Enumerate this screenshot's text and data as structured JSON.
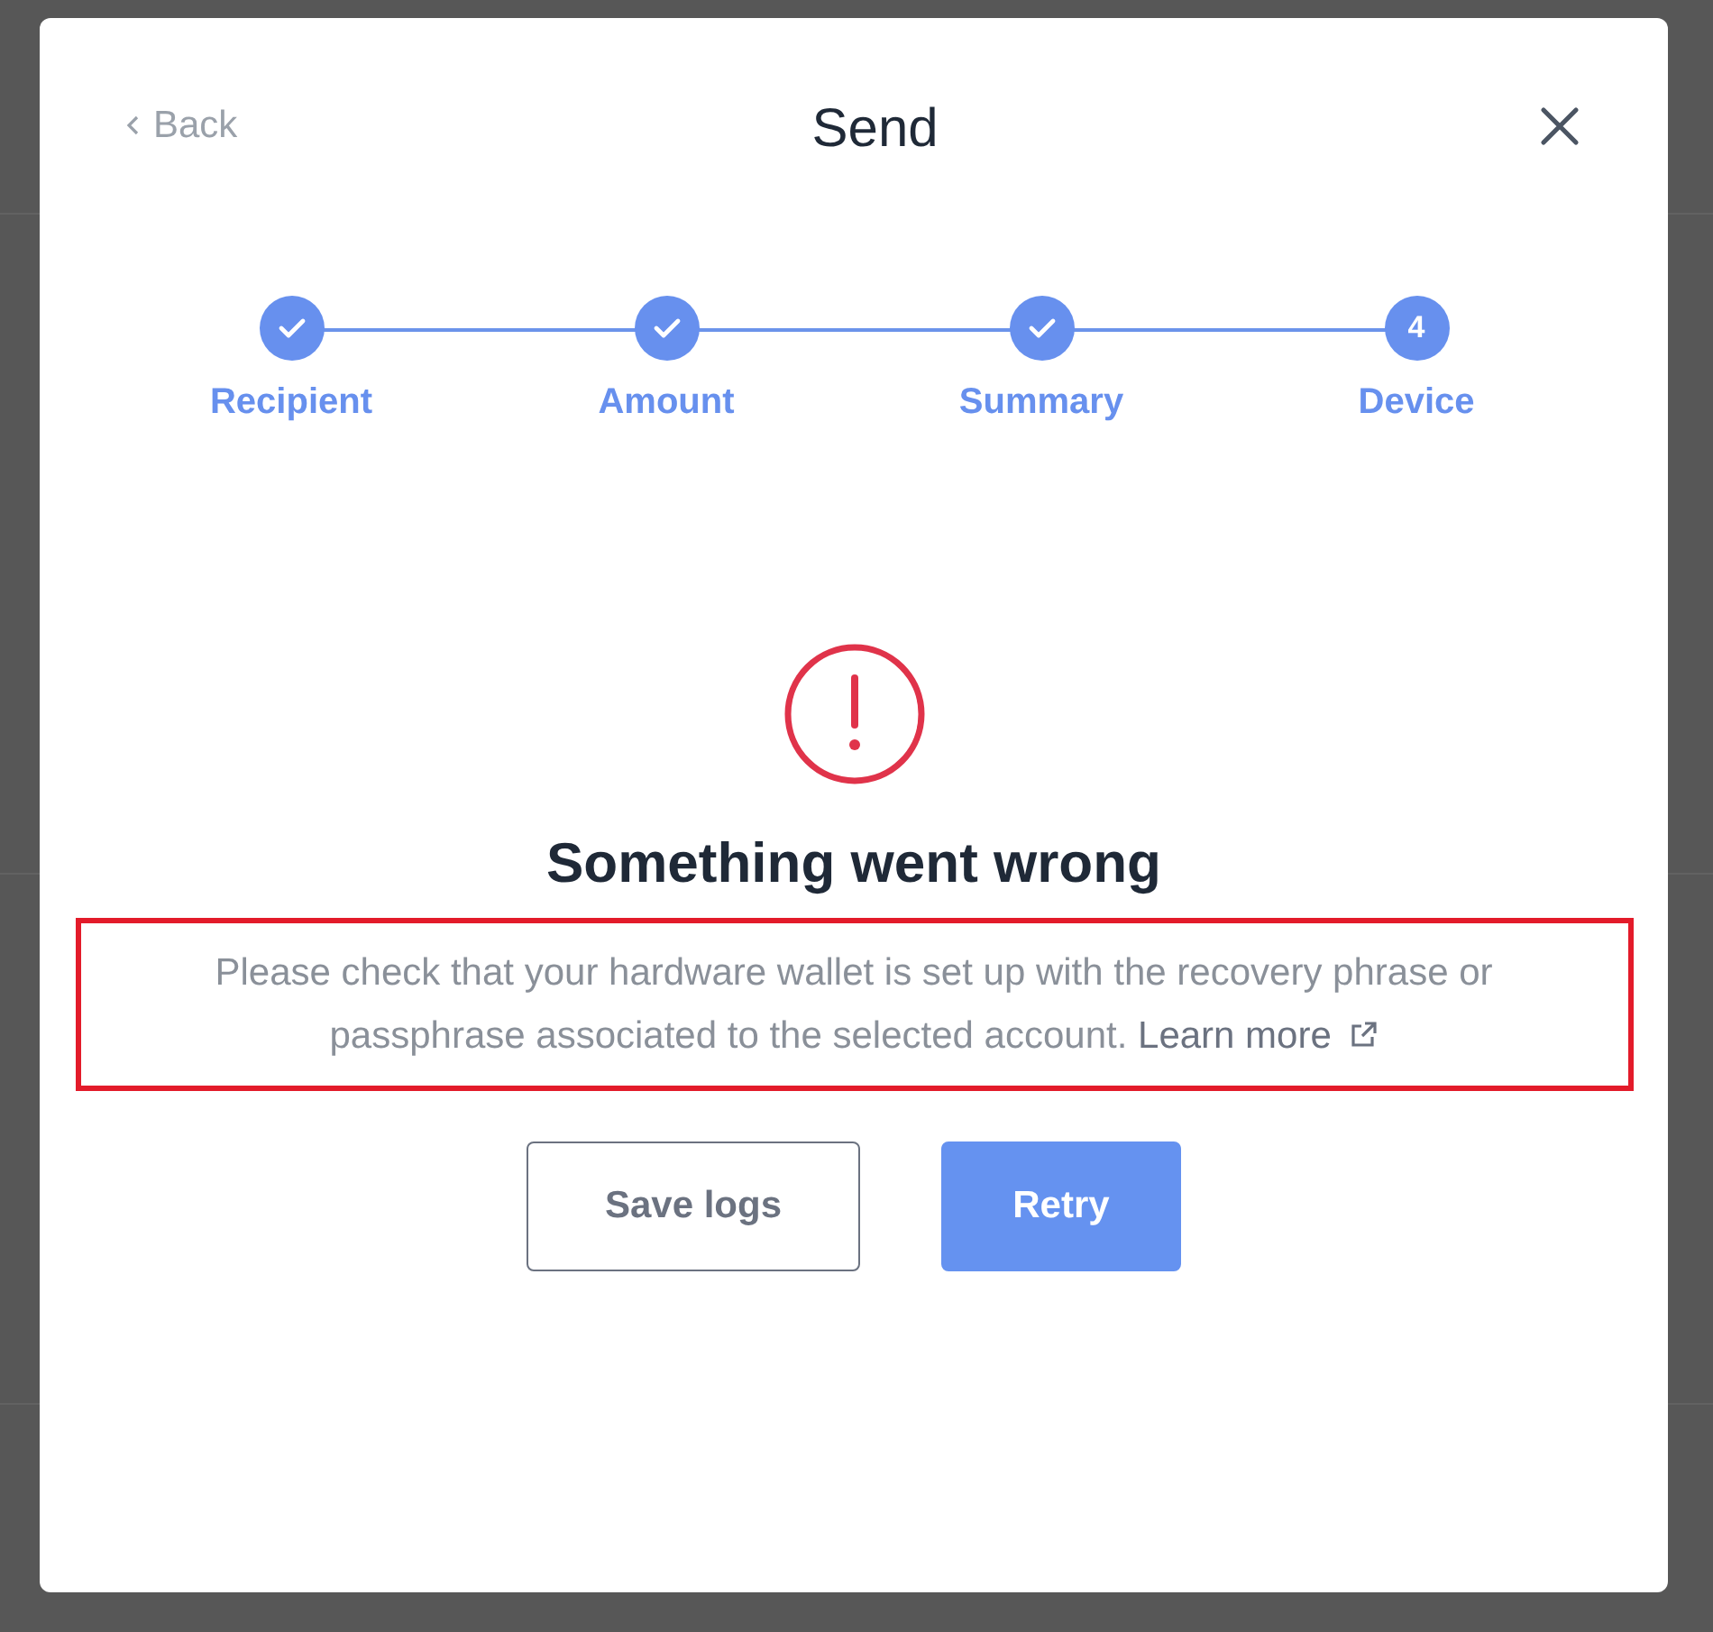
{
  "dialog": {
    "back": "Back",
    "title": "Send"
  },
  "steps": [
    {
      "label": "Recipient",
      "done": true
    },
    {
      "label": "Amount",
      "done": true
    },
    {
      "label": "Summary",
      "done": true
    },
    {
      "label": "Device",
      "done": false,
      "number": "4"
    }
  ],
  "error": {
    "title": "Something went wrong",
    "message": "Please check that your hardware wallet is set up with the recovery phrase or passphrase associated to the selected account.",
    "link": "Learn more",
    "highlighted": true
  },
  "buttons": [
    {
      "label": "Save logs",
      "kind": "secondary"
    },
    {
      "label": "Retry",
      "kind": "primary"
    }
  ]
}
